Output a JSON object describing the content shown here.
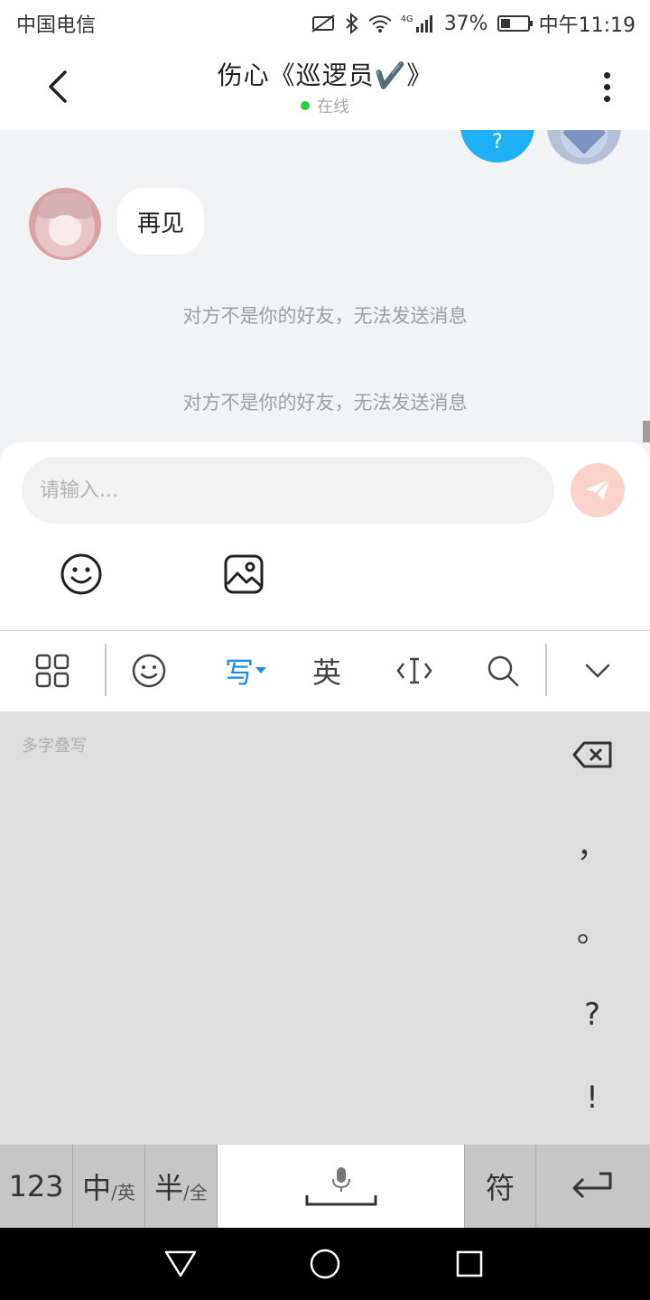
{
  "status_bar": {
    "carrier": "中国电信",
    "network": "4G",
    "battery": "37%",
    "battery_level": 0.37,
    "time": "中午11:19"
  },
  "header": {
    "title": "伤心《巡逻员✔️》",
    "status": "在线"
  },
  "chat": {
    "partial_top_text": "?",
    "messages": [
      {
        "sender": "other",
        "text": "再见"
      }
    ],
    "system_messages": [
      "对方不是你的好友，无法发送消息",
      "对方不是你的好友，无法发送消息"
    ]
  },
  "composer": {
    "placeholder": "请输入..."
  },
  "ime_toolbar": {
    "write_label": "写",
    "english_label": "英",
    "active_color": "#1a8be8"
  },
  "handwriting": {
    "hint": "多字叠写",
    "punctuation": [
      "，",
      "。",
      "?",
      "!"
    ]
  },
  "keyboard_row": {
    "num_key": "123",
    "lang_main": "中",
    "lang_sub": "/英",
    "width_main": "半",
    "width_sub": "/全",
    "symbol_key": "符"
  }
}
